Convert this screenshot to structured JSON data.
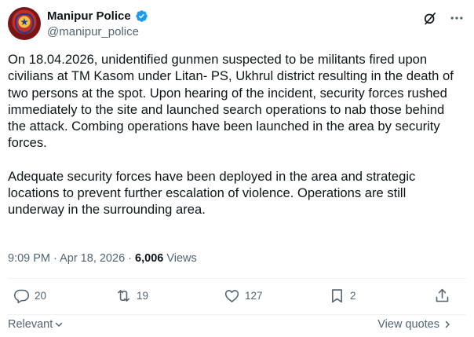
{
  "author": {
    "display_name": "Manipur Police",
    "handle": "@manipur_police",
    "verified_icon": "verified-badge-icon",
    "avatar_icon": "police-emblem"
  },
  "header_actions": {
    "grok_icon": "grok-icon",
    "more_icon": "more-dots-icon"
  },
  "tweet": {
    "paragraphs": [
      "On 18.04.2026, unidentified gunmen suspected to be militants fired upon civilians at TM Kasom under Litan- PS, Ukhrul district resulting in the death of two persons at the spot. Upon hearing of the incident, security forces rushed immediately to the site and launched search operations to nab those behind the attack. Combing operations have been launched in the area by security forces.",
      "Adequate security forces have been deployed in the area and strategic locations to prevent further escalation of violence. Operations are still underway in the surrounding area."
    ],
    "time": "9:09 PM",
    "separator": " · ",
    "date": "Apr 18, 2026",
    "separator2": " · ",
    "views_count": "6,006",
    "views_label": " Views"
  },
  "stats": {
    "replies": "20",
    "reposts": "19",
    "likes": "127",
    "bookmarks": "2"
  },
  "footer": {
    "sort_label": "Relevant",
    "view_quotes_label": "View quotes"
  },
  "colors": {
    "text_primary": "#0f1419",
    "text_secondary": "#536471",
    "verified_blue": "#1d9bf0",
    "divider": "#eff3f4"
  }
}
